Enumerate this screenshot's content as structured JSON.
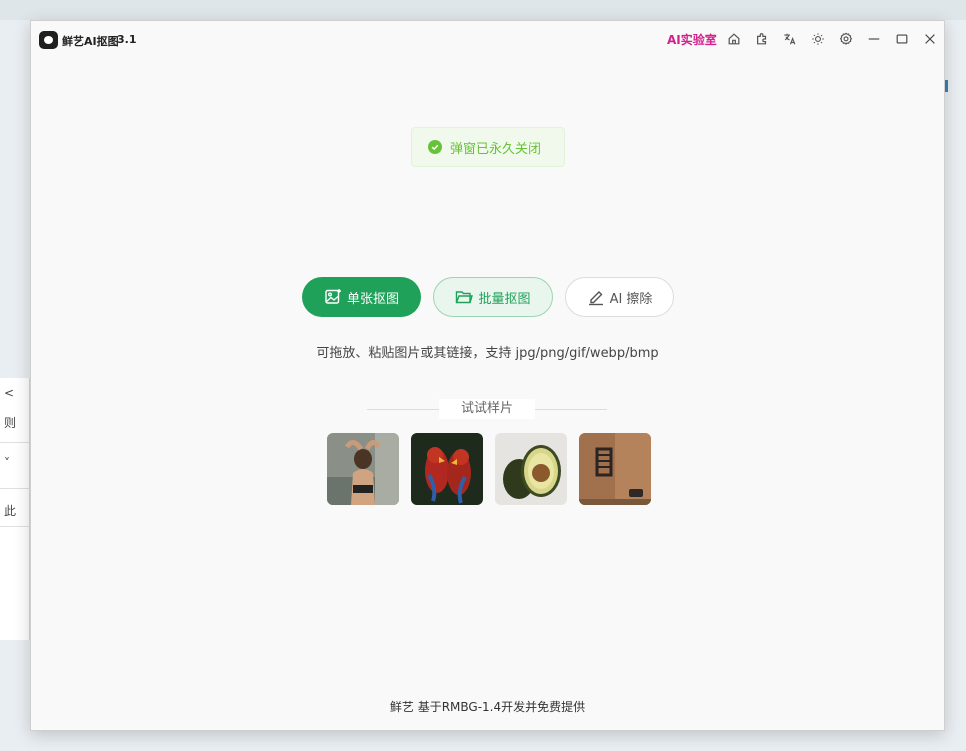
{
  "app": {
    "title": "鲜艺AI抠图",
    "version": "3.1",
    "lab_link": "AI实验室"
  },
  "toolbar_icons": [
    "home-icon",
    "plugin-icon",
    "translate-icon",
    "theme-icon",
    "settings-icon"
  ],
  "window_controls": [
    "minimize-icon",
    "maximize-icon",
    "close-icon"
  ],
  "toast": {
    "message": "弹窗已永久关闭",
    "color": "#67c23a"
  },
  "actions": {
    "single": "单张抠图",
    "batch": "批量抠图",
    "erase": "AI 擦除"
  },
  "hint": "可拖放、粘贴图片或其链接，支持 jpg/png/gif/webp/bmp",
  "samples": {
    "title": "试试样片",
    "items": [
      "woman-photo",
      "parrots-photo",
      "avocado-photo",
      "bathroom-photo"
    ]
  },
  "footer": "鲜艺 基于RMBG-1.4开发并免费提供",
  "colors": {
    "accent": "#20a159",
    "lab": "#d1218d"
  },
  "background": {
    "fragments": [
      "<",
      "则",
      "˅",
      "此"
    ]
  }
}
